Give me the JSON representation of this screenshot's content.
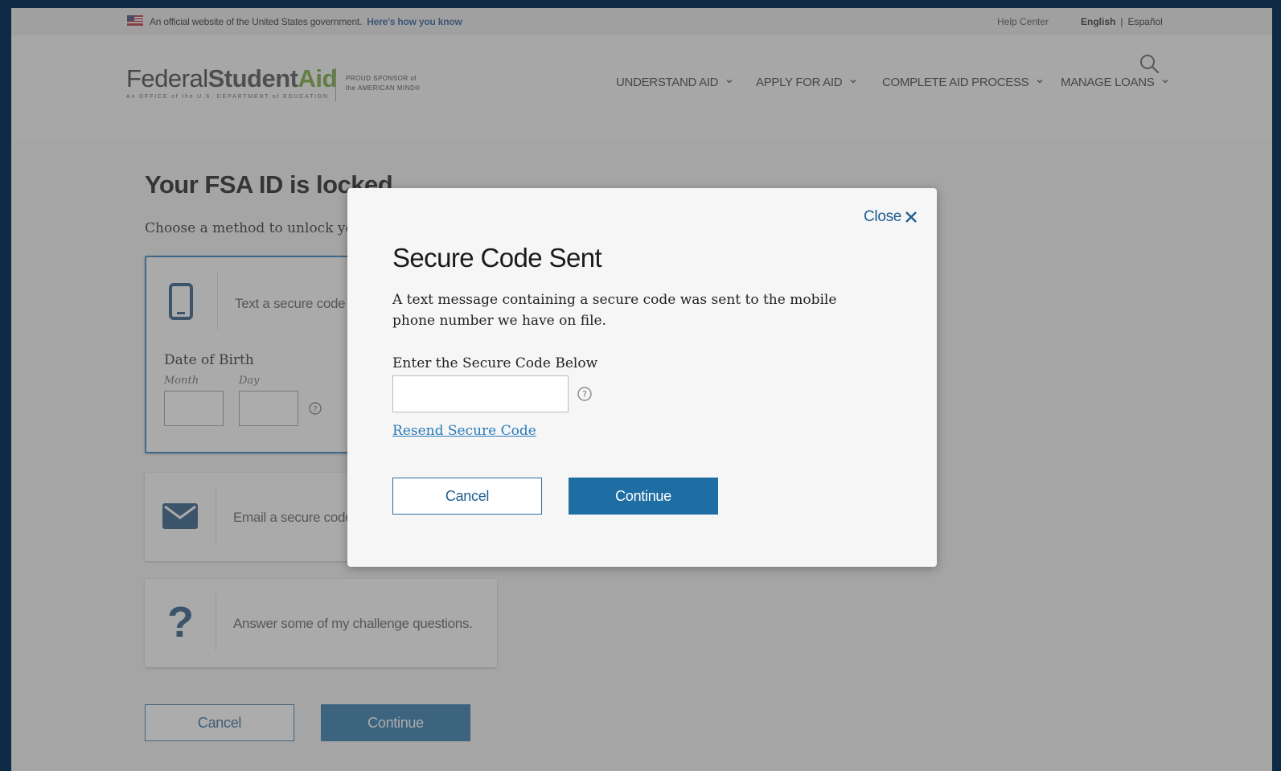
{
  "banner": {
    "official_text": "An official website of the United States government.",
    "how_you_know": "Here's how you know",
    "help_center": "Help Center",
    "lang_english": "English",
    "lang_sep": "|",
    "lang_espanol": "Español"
  },
  "header": {
    "logo_federal": "Federal",
    "logo_student": "Student",
    "logo_aid": "Aid",
    "logo_subtitle": "An OFFICE of the U.S. DEPARTMENT of EDUCATION",
    "sponsor_line1": "PROUD SPONSOR of",
    "sponsor_line2": "the AMERICAN MIND®",
    "nav": [
      {
        "label": "UNDERSTAND AID"
      },
      {
        "label": "APPLY FOR AID"
      },
      {
        "label": "COMPLETE AID PROCESS"
      },
      {
        "label": "MANAGE LOANS"
      }
    ]
  },
  "page": {
    "title": "Your FSA ID is locked",
    "subtitle": "Choose a method to unlock your FSA ID",
    "options": [
      {
        "text": "Text a secure code to my mobile phone"
      },
      {
        "text": "Email a secure code to my email address"
      },
      {
        "text": "Answer some of my challenge questions."
      }
    ],
    "dob_label": "Date of Birth",
    "dob_month": "Month",
    "dob_day": "Day",
    "cancel_label": "Cancel",
    "continue_label": "Continue"
  },
  "modal": {
    "close_label": "Close",
    "title": "Secure Code Sent",
    "message": "A text message containing a secure code was sent to the mobile phone number we have on file.",
    "input_label": "Enter the Secure Code Below",
    "input_value": "",
    "resend_label": "Resend Secure Code",
    "cancel_label": "Cancel",
    "continue_label": "Continue"
  },
  "colors": {
    "primary": "#1f6ea3",
    "link": "#2a7ab8",
    "logo_green": "#6aa22d"
  }
}
